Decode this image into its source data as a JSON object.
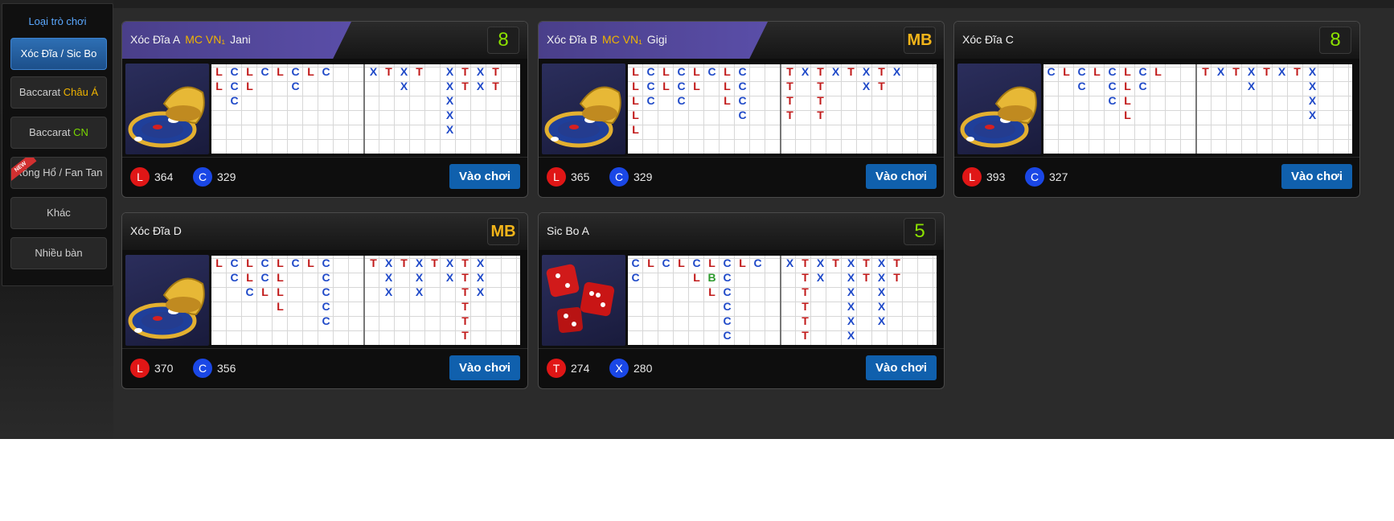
{
  "sidebar": {
    "title": "Loại trò chơi",
    "items": [
      {
        "label": "Xóc Đĩa / Sic Bo",
        "active": true
      },
      {
        "label": "Baccarat",
        "highlight": "Châu Á"
      },
      {
        "label": "Baccarat",
        "highlight": "CN"
      },
      {
        "label": "Rồng Hổ / Fan Tan",
        "ribbon": true
      },
      {
        "label": "Khác"
      },
      {
        "label": "Nhiều bàn"
      }
    ]
  },
  "colors": {
    "accent": "#1060ad",
    "red": "#e01616",
    "blue": "#1a47e6",
    "mb_gold": "#f3b51a",
    "badge_green": "#8be000"
  },
  "tables": [
    {
      "title": "Xóc Đĩa A",
      "mc": "MC VN₁",
      "dealer": "Jani",
      "badge": "8",
      "badge_type": "num",
      "thumb": "bowl-icon",
      "stat1_symbol": "L",
      "stat1_value": "364",
      "stat2_symbol": "C",
      "stat2_value": "329",
      "play": "Vào chơi",
      "road1": [
        [
          "L",
          "L",
          ""
        ],
        [
          "C",
          "C",
          "C"
        ],
        [
          "L",
          "L",
          ""
        ],
        [
          "C",
          "",
          ""
        ],
        [
          "L",
          "",
          ""
        ],
        [
          "C",
          "C",
          ""
        ],
        [
          "L",
          "",
          ""
        ],
        [
          "C",
          "",
          ""
        ]
      ],
      "road2": [
        [
          "X",
          ""
        ],
        [
          "T",
          ""
        ],
        [
          "X",
          "X"
        ],
        [
          "T",
          ""
        ],
        [
          "",
          ""
        ],
        [
          "X",
          "X",
          "X",
          "X",
          "X"
        ],
        [
          "T",
          "T"
        ],
        [
          "X",
          "X"
        ],
        [
          "T",
          "T"
        ]
      ]
    },
    {
      "title": "Xóc Đĩa B",
      "mc": "MC VN₁",
      "dealer": "Gigi",
      "badge": "MB",
      "badge_type": "mb",
      "thumb": "bowl-icon",
      "stat1_symbol": "L",
      "stat1_value": "365",
      "stat2_symbol": "C",
      "stat2_value": "329",
      "play": "Vào chơi",
      "road1": [
        [
          "L",
          "L",
          "L",
          "L",
          "L"
        ],
        [
          "C",
          "C",
          "C"
        ],
        [
          "L",
          "L",
          ""
        ],
        [
          "C",
          "C",
          "C"
        ],
        [
          "L",
          "L",
          ""
        ],
        [
          "C",
          "",
          ""
        ],
        [
          "L",
          "L",
          "L"
        ],
        [
          "C",
          "C",
          "C",
          "C"
        ]
      ],
      "road2": [
        [
          "T",
          "T",
          "T",
          "T"
        ],
        [
          "X",
          ""
        ],
        [
          "T",
          "T",
          "T",
          "T"
        ],
        [
          "X",
          ""
        ],
        [
          "T",
          ""
        ],
        [
          "X",
          "X"
        ],
        [
          "T",
          "T"
        ],
        [
          "X",
          ""
        ]
      ]
    },
    {
      "title": "Xóc Đĩa C",
      "mc": "",
      "dealer": "",
      "badge": "8",
      "badge_type": "num",
      "thumb": "bowl-icon",
      "stat1_symbol": "L",
      "stat1_value": "393",
      "stat2_symbol": "C",
      "stat2_value": "327",
      "play": "Vào chơi",
      "road1": [
        [
          "C",
          ""
        ],
        [
          "L",
          ""
        ],
        [
          "C",
          "C"
        ],
        [
          "L",
          ""
        ],
        [
          "C",
          "C",
          "C"
        ],
        [
          "L",
          "L",
          "L",
          "L"
        ],
        [
          "C",
          "C"
        ],
        [
          "L",
          ""
        ]
      ],
      "road2": [
        [
          "T",
          ""
        ],
        [
          "X",
          ""
        ],
        [
          "T",
          ""
        ],
        [
          "X",
          "X"
        ],
        [
          "T",
          ""
        ],
        [
          "X",
          ""
        ],
        [
          "T",
          ""
        ],
        [
          "X",
          "X",
          "X",
          "X"
        ]
      ]
    },
    {
      "title": "Xóc Đĩa D",
      "mc": "",
      "dealer": "",
      "badge": "MB",
      "badge_type": "mb",
      "thumb": "bowl-icon",
      "stat1_symbol": "L",
      "stat1_value": "370",
      "stat2_symbol": "C",
      "stat2_value": "356",
      "play": "Vào chơi",
      "road1": [
        [
          "L",
          ""
        ],
        [
          "C",
          "C"
        ],
        [
          "L",
          "L",
          "C"
        ],
        [
          "C",
          "C",
          "L"
        ],
        [
          "L",
          "L",
          "L",
          "L"
        ],
        [
          "C",
          ""
        ],
        [
          "L",
          ""
        ],
        [
          "C",
          "C",
          "C",
          "C",
          "C"
        ]
      ],
      "road2": [
        [
          "T",
          ""
        ],
        [
          "X",
          "X",
          "X"
        ],
        [
          "T",
          ""
        ],
        [
          "X",
          "X",
          "X"
        ],
        [
          "T",
          ""
        ],
        [
          "X",
          "X"
        ],
        [
          "T",
          "T",
          "T",
          "T",
          "T",
          "T"
        ],
        [
          "X",
          "X",
          "X"
        ]
      ]
    },
    {
      "title": "Sic Bo A",
      "mc": "",
      "dealer": "",
      "badge": "5",
      "badge_type": "num",
      "thumb": "dice-icon",
      "stat1_symbol": "T",
      "stat1_value": "274",
      "stat2_symbol": "X",
      "stat2_value": "280",
      "play": "Vào chơi",
      "road1": [
        [
          "C",
          "C"
        ],
        [
          "L",
          ""
        ],
        [
          "C",
          ""
        ],
        [
          "L",
          ""
        ],
        [
          "C",
          "L"
        ],
        [
          "L",
          "B",
          "L"
        ],
        [
          "C",
          "C",
          "C",
          "C",
          "C",
          "C"
        ],
        [
          "L",
          ""
        ],
        [
          "C",
          ""
        ]
      ],
      "road2": [
        [
          "X",
          ""
        ],
        [
          "T",
          "T",
          "T",
          "T",
          "T",
          "T"
        ],
        [
          "X",
          "X"
        ],
        [
          "T",
          ""
        ],
        [
          "X",
          "X",
          "X",
          "X",
          "X",
          "X"
        ],
        [
          "T",
          "T"
        ],
        [
          "X",
          "X",
          "X",
          "X",
          "X"
        ],
        [
          "T",
          "T"
        ]
      ]
    }
  ]
}
